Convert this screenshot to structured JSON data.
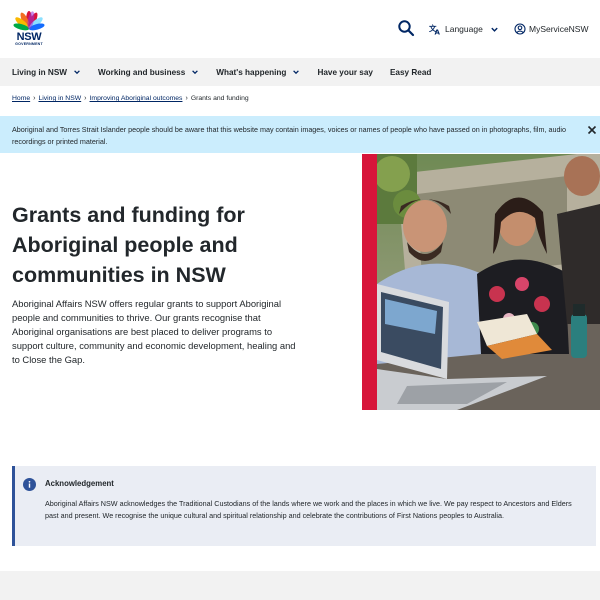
{
  "header": {
    "logo_text": "NSW",
    "logo_subtext": "GOVERNMENT",
    "search_icon": "search-icon",
    "language_label": "Language",
    "myservice_label": "MyServiceNSW"
  },
  "nav": {
    "items": [
      {
        "label": "Living in NSW",
        "has_dropdown": true
      },
      {
        "label": "Working and business",
        "has_dropdown": true
      },
      {
        "label": "What's happening",
        "has_dropdown": true
      },
      {
        "label": "Have your say",
        "has_dropdown": false
      },
      {
        "label": "Easy Read",
        "has_dropdown": false
      }
    ]
  },
  "breadcrumb": {
    "items": [
      "Home",
      "Living in NSW",
      "Improving Aboriginal outcomes"
    ],
    "current": "Grants and funding"
  },
  "alert": {
    "text": "Aboriginal and Torres Strait Islander people should be aware that this website may contain images, voices or names of people who have passed on in photographs, film, audio recordings or printed material."
  },
  "hero": {
    "title": "Grants and funding for Aboriginal people and communities in NSW",
    "description": "Aboriginal Affairs NSW offers regular grants to support Aboriginal people and communities to thrive. Our grants recognise that Aboriginal organisations are best placed to deliver programs to support culture, community and economic development, healing and to Close the Gap."
  },
  "acknowledgement": {
    "title": "Acknowledgement",
    "text": "Aboriginal Affairs NSW acknowledges the Traditional Custodians of the lands where we work and the places in which we live. We pay respect to Ancestors and Elders past and present. We recognise the unique cultural and spiritual relationship and celebrate the contributions of First Nations peoples to Australia."
  },
  "colors": {
    "brand_navy": "#002664",
    "accent_red": "#d7153a",
    "alert_bg": "#cbedfd",
    "nav_bg": "#f2f2f2",
    "ack_bg": "#eaedf4"
  }
}
